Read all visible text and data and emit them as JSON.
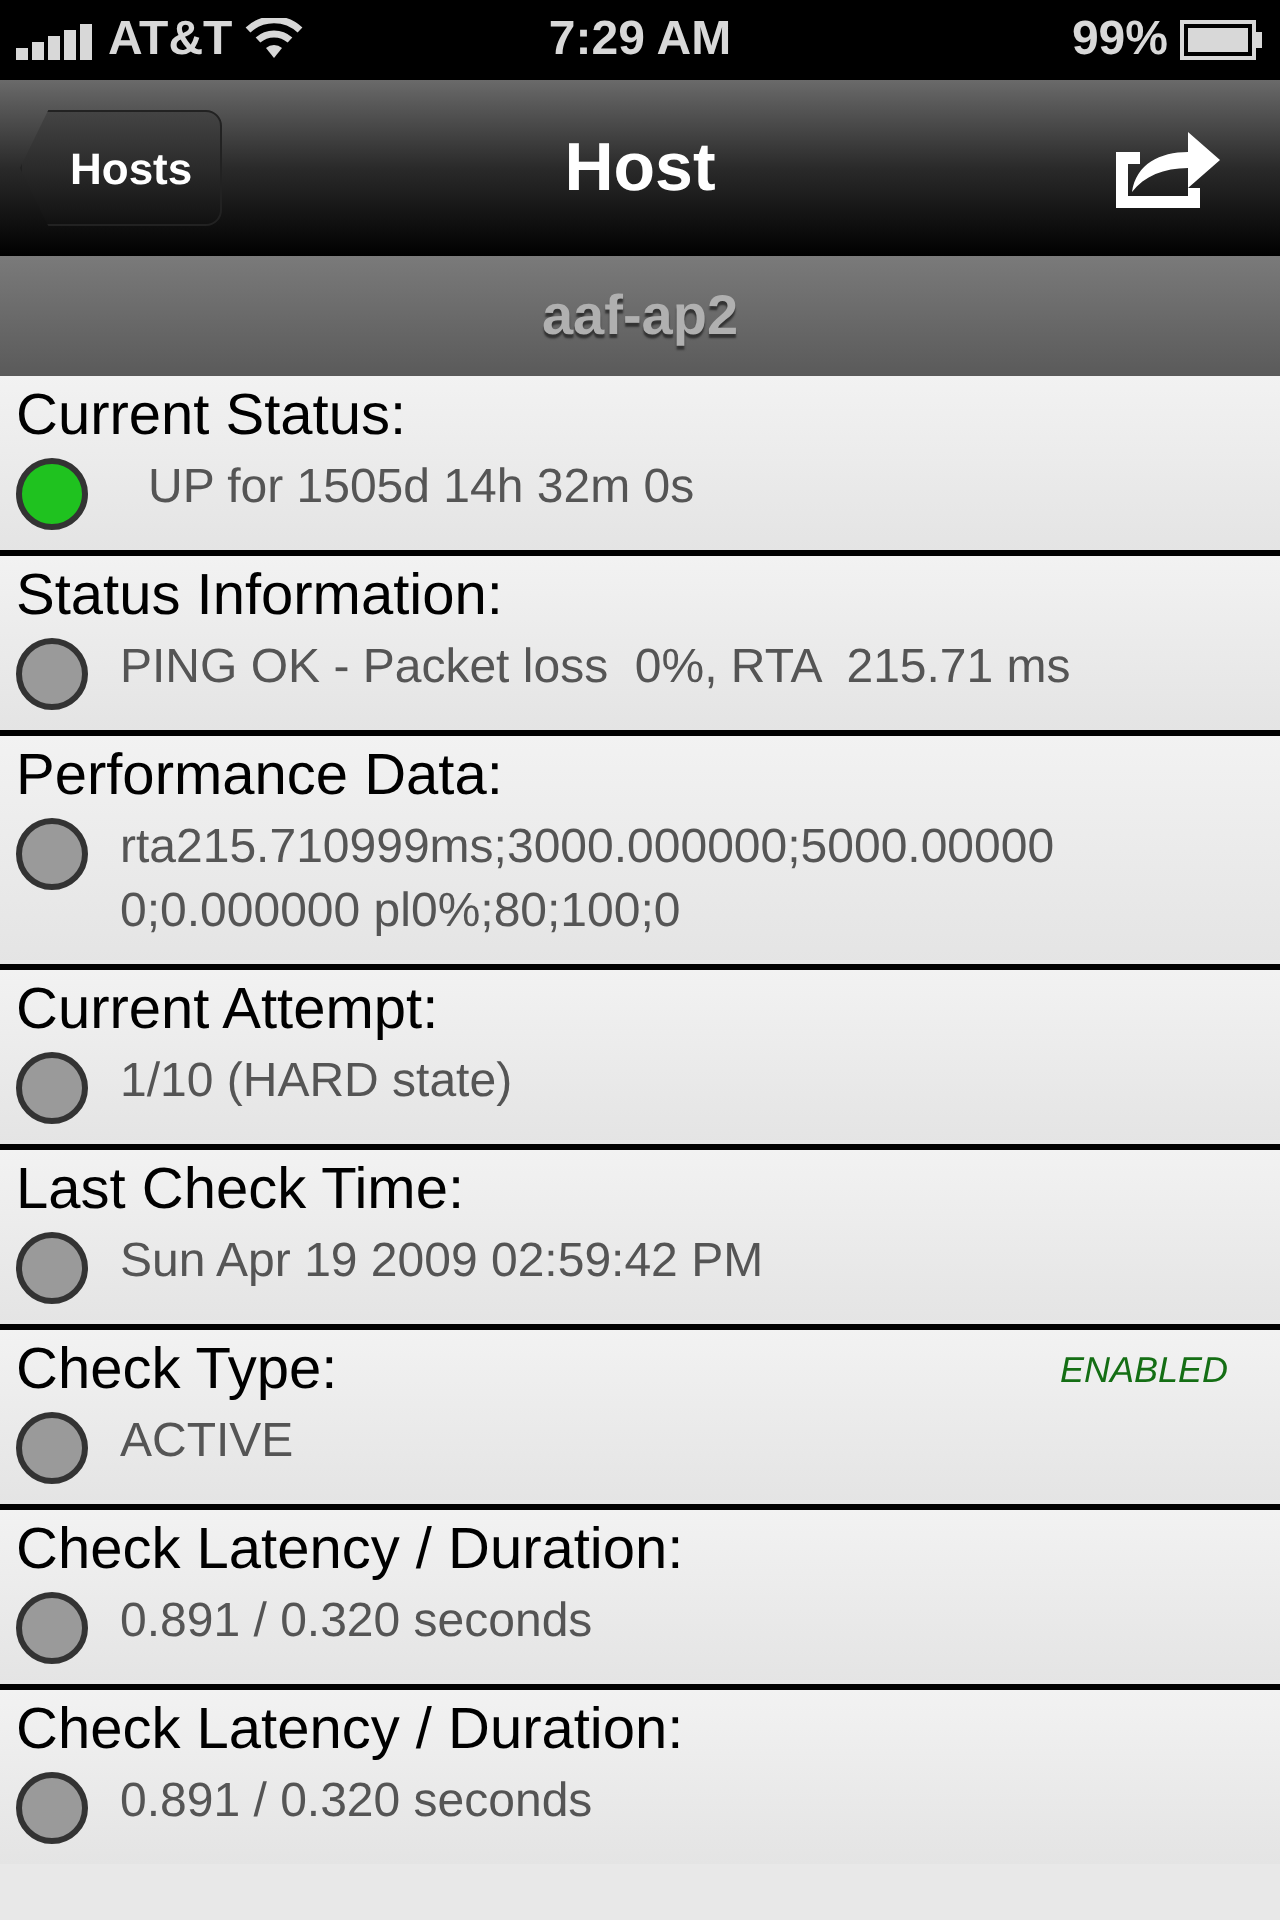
{
  "status_bar": {
    "carrier": "AT&T",
    "time": "7:29 AM",
    "battery": "99%"
  },
  "nav": {
    "back": "Hosts",
    "title": "Host"
  },
  "host_name": "aaf-ap2",
  "rows": [
    {
      "label": "Current Status:",
      "value": "UP for 1505d 14h 32m 0s",
      "color": "#1fc21f"
    },
    {
      "label": "Status Information:",
      "value": "PING OK - Packet loss  0%, RTA  215.71 ms",
      "color": "#9a9a9a"
    },
    {
      "label": "Performance Data:",
      "value": "rta215.710999ms;3000.000000;5000.000000;0.000000 pl0%;80;100;0",
      "color": "#9a9a9a"
    },
    {
      "label": "Current Attempt:",
      "value": "1/10 (HARD state)",
      "color": "#9a9a9a"
    },
    {
      "label": "Last Check Time:",
      "value": "Sun Apr 19 2009 02:59:42 PM",
      "color": "#9a9a9a"
    },
    {
      "label": "Check Type:",
      "value": "ACTIVE",
      "color": "#9a9a9a",
      "badge": "ENABLED"
    },
    {
      "label": "Check Latency / Duration:",
      "value": "0.891 / 0.320 seconds",
      "color": "#9a9a9a"
    },
    {
      "label": "Check Latency / Duration:",
      "value": "0.891 / 0.320 seconds",
      "color": "#9a9a9a"
    }
  ]
}
